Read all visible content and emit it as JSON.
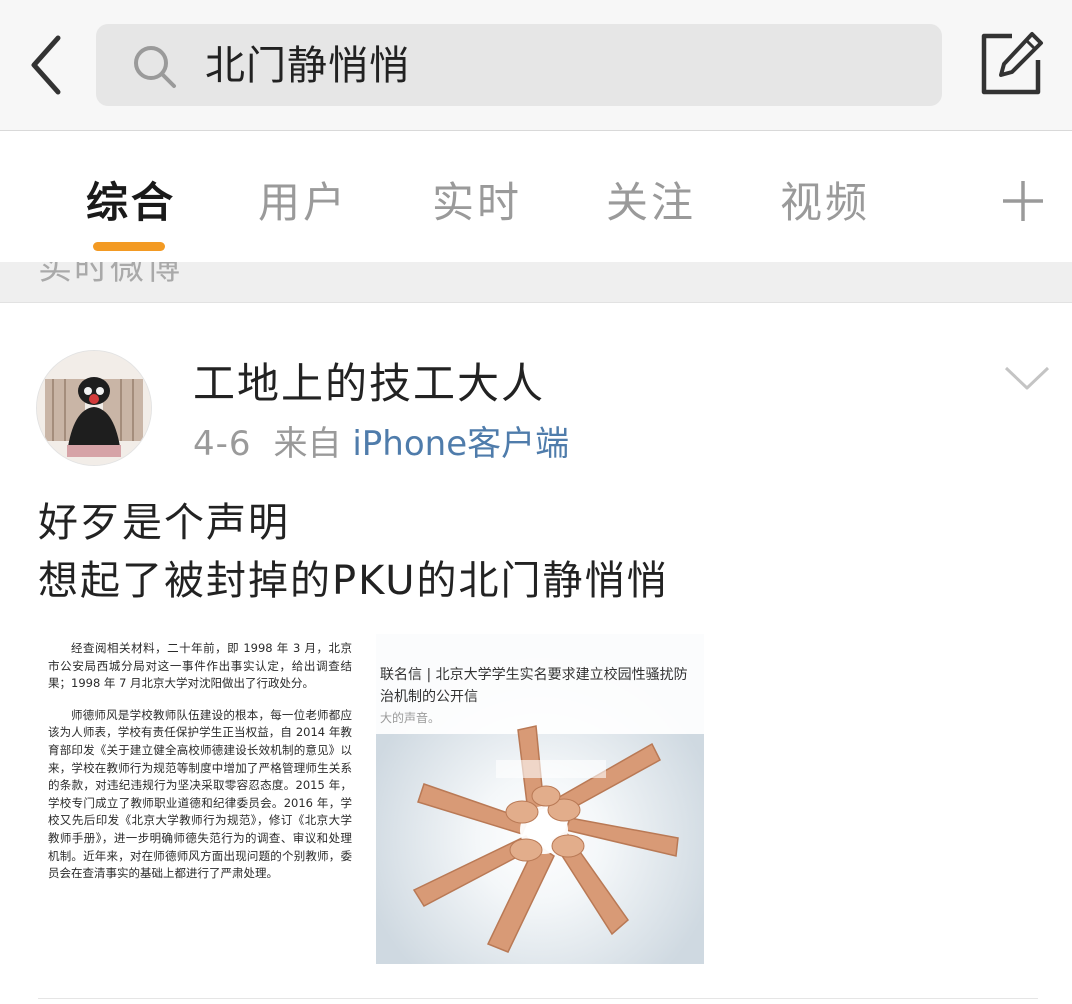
{
  "search": {
    "query": "北门静悄悄"
  },
  "tabs": [
    {
      "label": "综合",
      "active": true
    },
    {
      "label": "用户",
      "active": false
    },
    {
      "label": "实时",
      "active": false
    },
    {
      "label": "关注",
      "active": false
    },
    {
      "label": "视频",
      "active": false
    }
  ],
  "section_header": "实时微博",
  "post": {
    "username": "工地上的技工大人",
    "date": "4-6",
    "source_prefix": "来自",
    "source_client": "iPhone客户端",
    "text_lines": [
      "好歹是个声明",
      "想起了被封掉的PKU的北门静悄悄"
    ],
    "images": {
      "left_document": {
        "para1": "经查阅相关材料，二十年前，即 1998 年 3 月，北京市公安局西城分局对这一事件作出事实认定，给出调查结果；1998 年 7 月北京大学对沈阳做出了行政处分。",
        "para2": "师德师风是学校教师队伍建设的根本，每一位老师都应该为人师表，学校有责任保护学生正当权益，自 2014 年教育部印发《关于建立健全高校师德建设长效机制的意见》以来，学校在教师行为规范等制度中增加了严格管理师生关系的条款，对违纪违规行为坚决采取零容忍态度。2015 年，学校专门成立了教师职业道德和纪律委员会。2016 年，学校又先后印发《北京大学教师行为规范》，修订《北京大学教师手册》，进一步明确师德失范行为的调查、审议和处理机制。近年来，对在师德师风方面出现问题的个别教师，委员会在查清事实的基础上都进行了严肃处理。"
      },
      "right_image": {
        "headline": "联名信 | 北京大学学生实名要求建立校园性骚扰防治机制的公开信",
        "subtext": "大的声音。"
      }
    }
  },
  "colors": {
    "accent": "#f39a23",
    "link": "#4f7cab",
    "muted": "#9a9a9a",
    "text": "#222222"
  },
  "icons": {
    "back": "chevron-left-icon",
    "search": "search-icon",
    "compose": "compose-icon",
    "add_tab": "plus-icon",
    "post_menu": "chevron-down-icon"
  }
}
